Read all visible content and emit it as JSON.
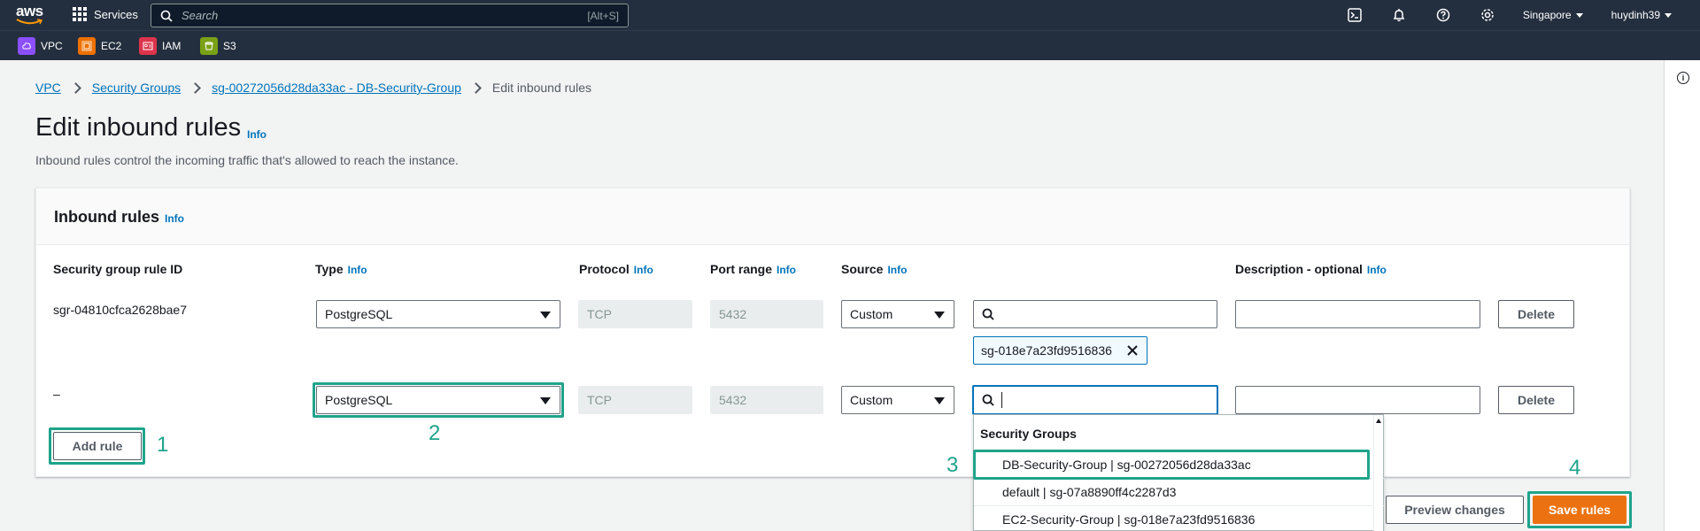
{
  "topnav": {
    "logo_text": "aws",
    "services_label": "Services",
    "search_placeholder": "Search",
    "search_shortcut": "[Alt+S]",
    "region": "Singapore",
    "user": "huydinh39",
    "icons": [
      "cloudshell-icon",
      "bell-icon",
      "help-icon",
      "gear-icon"
    ]
  },
  "favorites": [
    {
      "label": "VPC",
      "color": "#8c4fff",
      "icon": "vpc-icon"
    },
    {
      "label": "EC2",
      "color": "#ed7100",
      "icon": "ec2-icon"
    },
    {
      "label": "IAM",
      "color": "#dd344c",
      "icon": "iam-icon"
    },
    {
      "label": "S3",
      "color": "#7aa116",
      "icon": "s3-icon"
    }
  ],
  "breadcrumb": {
    "items": [
      "VPC",
      "Security Groups",
      "sg-00272056d28da33ac - DB-Security-Group"
    ],
    "current": "Edit inbound rules"
  },
  "page": {
    "title": "Edit inbound rules",
    "info": "Info",
    "subtitle": "Inbound rules control the incoming traffic that's allowed to reach the instance."
  },
  "panel": {
    "title": "Inbound rules",
    "info": "Info",
    "columns": {
      "rule_id": "Security group rule ID",
      "type": "Type",
      "protocol": "Protocol",
      "port_range": "Port range",
      "source": "Source",
      "description": "Description - optional"
    }
  },
  "rules": [
    {
      "id": "sgr-04810cfca2628bae7",
      "type": "PostgreSQL",
      "protocol": "TCP",
      "port": "5432",
      "source": "Custom",
      "token": "sg-018e7a23fd9516836",
      "delete": "Delete"
    },
    {
      "id": "–",
      "type": "PostgreSQL",
      "protocol": "TCP",
      "port": "5432",
      "source": "Custom",
      "delete": "Delete"
    }
  ],
  "add_rule": "Add rule",
  "dropdown": {
    "header": "Security Groups",
    "items": [
      "DB-Security-Group | sg-00272056d28da33ac",
      "default | sg-07a8890ff4c2287d3",
      "EC2-Security-Group | sg-018e7a23fd9516836"
    ]
  },
  "footer": {
    "preview": "Preview changes",
    "save": "Save rules"
  },
  "steps": [
    "1",
    "2",
    "3",
    "4"
  ],
  "colors": {
    "accent": "#ec7211",
    "highlight": "#1fa48b",
    "link": "#0073bb",
    "nav": "#232f3e"
  }
}
